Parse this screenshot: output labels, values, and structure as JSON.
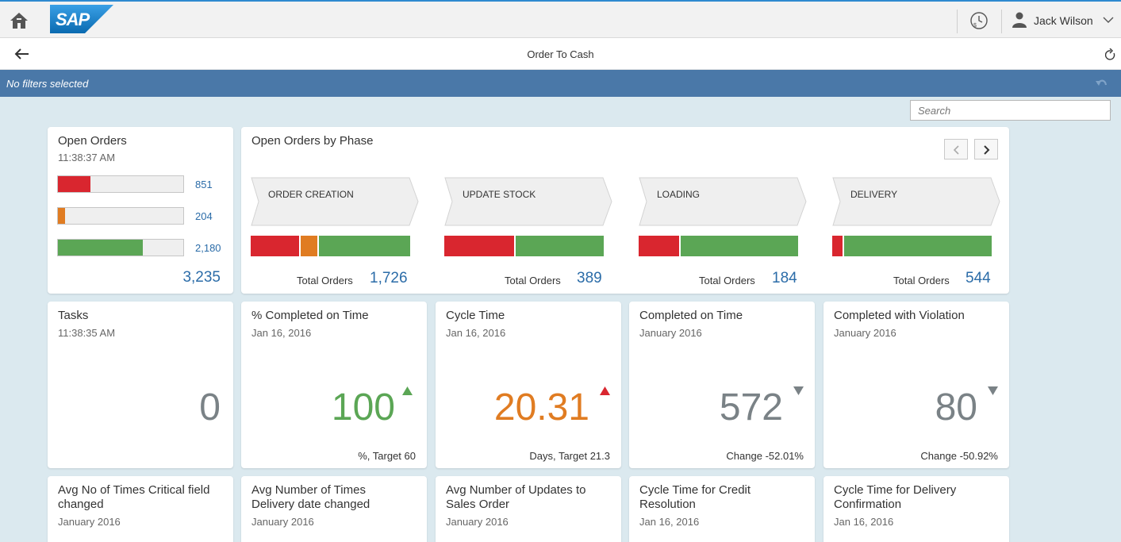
{
  "shell": {
    "user_name": "Jack Wilson",
    "logo_text": "SAP"
  },
  "header": {
    "title": "Order To Cash"
  },
  "filterbar": {
    "text": "No filters selected"
  },
  "search": {
    "placeholder": "Search"
  },
  "open_orders": {
    "title": "Open Orders",
    "time": "11:38:37 AM",
    "bars": [
      {
        "label": "851",
        "fill": 0.26,
        "color": "#d9262f"
      },
      {
        "label": "204",
        "fill": 0.06,
        "color": "#e07c22"
      },
      {
        "label": "2,180",
        "fill": 0.68,
        "color": "#5ba655"
      }
    ],
    "total": "3,235"
  },
  "phases": {
    "title": "Open Orders by Phase",
    "total_label": "Total Orders",
    "items": [
      {
        "name": "ORDER CREATION",
        "total": "1,726",
        "segments": [
          {
            "fraction": 0.31,
            "color": "#d9262f"
          },
          {
            "fraction": 0.12,
            "color": "#e07c22"
          },
          {
            "fraction": 0.57,
            "color": "#5ba655"
          }
        ]
      },
      {
        "name": "UPDATE STOCK",
        "total": "389",
        "segments": [
          {
            "fraction": 0.44,
            "color": "#d9262f"
          },
          {
            "fraction": 0.56,
            "color": "#5ba655"
          }
        ]
      },
      {
        "name": "LOADING",
        "total": "184",
        "segments": [
          {
            "fraction": 0.26,
            "color": "#d9262f"
          },
          {
            "fraction": 0.74,
            "color": "#5ba655"
          }
        ]
      },
      {
        "name": "DELIVERY",
        "total": "544",
        "segments": [
          {
            "fraction": 0.07,
            "color": "#d9262f"
          },
          {
            "fraction": 0.93,
            "color": "#5ba655"
          }
        ]
      }
    ]
  },
  "tasks": {
    "title": "Tasks",
    "time": "11:38:35 AM",
    "value": "0"
  },
  "kpis": [
    {
      "title": "% Completed on Time",
      "date": "Jan 16, 2016",
      "value": "100",
      "color": "#5ba655",
      "trend": "up",
      "trend_color": "#5ba655",
      "foot": "%, Target 60"
    },
    {
      "title": "Cycle Time",
      "date": "Jan 16, 2016",
      "value": "20.31",
      "color": "#e07c22",
      "trend": "up",
      "trend_color": "#d9262f",
      "foot": "Days, Target 21.3"
    },
    {
      "title": "Completed on Time",
      "date": "January 2016",
      "value": "572",
      "color": "#7a8286",
      "trend": "down",
      "trend_color": "#7a8286",
      "foot": "Change -52.01%"
    },
    {
      "title": "Completed with Violation",
      "date": "January 2016",
      "value": "80",
      "color": "#7a8286",
      "trend": "down",
      "trend_color": "#7a8286",
      "foot": "Change -50.92%"
    }
  ],
  "bottom_tiles": [
    {
      "title_line1": "Avg No of Times Critical field",
      "title_line2": "changed",
      "date": "January 2016"
    },
    {
      "title_line1": "Avg Number of Times",
      "title_line2": "Delivery date changed",
      "date": "January 2016"
    },
    {
      "title_line1": "Avg Number of Updates to",
      "title_line2": "Sales Order",
      "date": "January 2016"
    },
    {
      "title_line1": "Cycle Time for Credit",
      "title_line2": "Resolution",
      "date": "Jan 16, 2016"
    },
    {
      "title_line1": "Cycle Time for Delivery",
      "title_line2": "Confirmation",
      "date": "Jan 16, 2016"
    }
  ]
}
